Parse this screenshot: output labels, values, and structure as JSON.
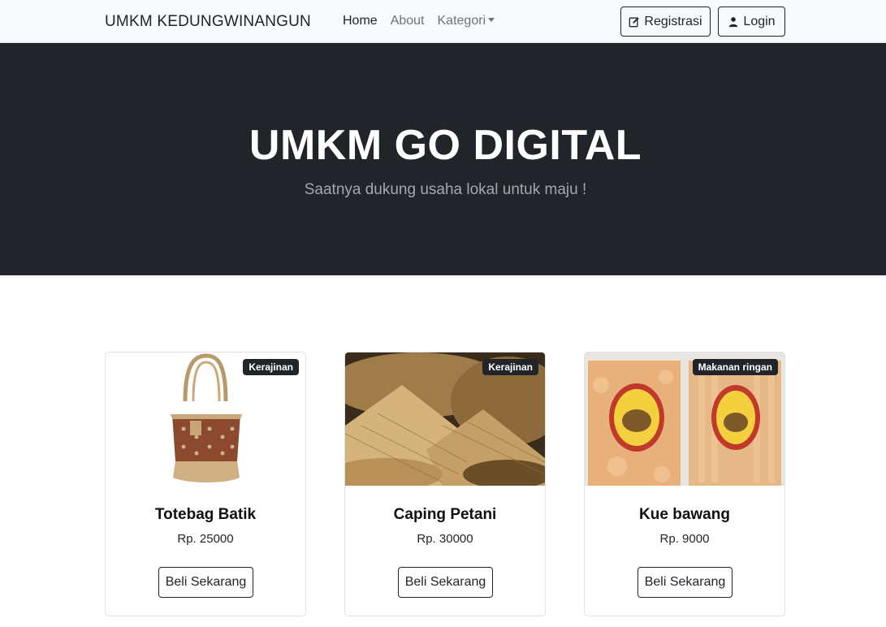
{
  "navbar": {
    "brand": "UMKM KEDUNGWINANGUN",
    "links": [
      {
        "label": "Home"
      },
      {
        "label": "About"
      },
      {
        "label": "Kategori"
      }
    ],
    "register_label": "Registrasi",
    "login_label": "Login"
  },
  "hero": {
    "title": "UMKM GO DIGITAL",
    "subtitle": "Saatnya dukung usaha lokal untuk maju !"
  },
  "products": [
    {
      "name": "Totebag Batik",
      "price": "Rp. 25000",
      "category": "Kerajinan",
      "button": "Beli Sekarang"
    },
    {
      "name": "Caping Petani",
      "price": "Rp. 30000",
      "category": "Kerajinan",
      "button": "Beli Sekarang"
    },
    {
      "name": "Kue bawang",
      "price": "Rp. 9000",
      "category": "Makanan ringan",
      "button": "Beli Sekarang"
    }
  ]
}
